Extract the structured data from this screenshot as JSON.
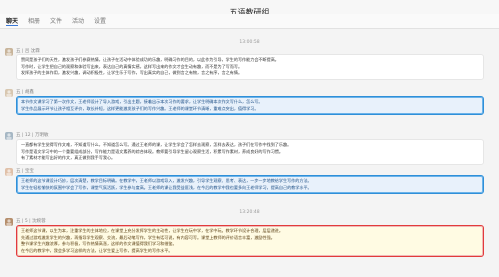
{
  "window": {
    "title": "五语教研组"
  },
  "tabs": [
    {
      "label": "聊天",
      "active": true
    },
    {
      "label": "相册",
      "active": false
    },
    {
      "label": "文件",
      "active": false
    },
    {
      "label": "活动",
      "active": false
    },
    {
      "label": "设置",
      "active": false
    }
  ],
  "messages": [
    {
      "time": "13:00:58",
      "sender": "五 | 吕 沈霖",
      "style": "white",
      "avatar_color": "#c8b49a",
      "lines": [
        "赞同是孩子们的天性，激发孩子们参赛热情，让孩子在活动中体验成功的乐趣，明确习作的目的，以此作为引导，学生的写作能力会不断提高。",
        "写作时，让学生把自己的观察和体验写出来，表达自己的真情实感，这样写出来的作文才会生动有趣，而不是为了写而写。",
        "发挥孩子的主体作用，激发兴趣，调动积极性，让学生乐于写作，写出真实的自己，做到言之有物，言之有序，言之有情。"
      ]
    },
    {
      "time": "",
      "sender": "五 | 胡鑫",
      "style": "blue",
      "avatar_color": "#d8c7b0",
      "lines": [
        "本节作文课学习了第一次作文，王老师设计了导入游戏，引出主题，接着出示本次习作的要求，让学生明确本次作文写什么，怎么写。",
        "学生作品展示环节让孩子相互评价，取长补短，这样更能激发孩子们的写作兴趣。王老师的课堂环节清晰，重难点突出，值得学习。"
      ]
    },
    {
      "time": "",
      "sender": "五 | 12 | 万明敏",
      "style": "white",
      "avatar_color": "#a6b7c4",
      "lines": [
        "一直都有学生觉得写作文难，不知道写什么，不知道怎么写。通过王老师的课，让学生学会了怎样去观察，怎样去表达，孩子们在写作中找到了乐趣。",
        "写作是语文学习中的一个重要组成部分，写作能力是语文素养的综合体现。教师要引导学生留心观察生活，积累写作素材，养成良好的写作习惯。",
        "有了素材才能写出好的作文，真正做到我手写我心。"
      ]
    },
    {
      "time": "",
      "sender": "五 | 宝宝",
      "style": "blue",
      "avatar_color": "#e0c0a8",
      "lines": [
        "王老师的这节课设计巧妙，层次清楚，教学目标明确。在教学中，王老师以游戏导入，激发兴趣，引导学生观察、思考、表达，一步一步地教给学生写作的方法。",
        "学生在轻松愉快的氛围中学会了写作，课堂气氛活跃，学生参与度高。王老师的课让我受益匪浅，在今后的教学中我也要多向王老师学习，提高自己的教学水平。"
      ]
    },
    {
      "time": "13:20:48",
      "sender": "五 | 5 | 沈婉蓉",
      "style": "yellow",
      "avatar_color": "#b58e6c",
      "lines": [
        "王老师这节课，以生为本，注重学生的主体地位，在课堂上充分发挥学生的主动性，让学生在玩中学，在学中玩。教学环节设计合理，层层递进。",
        "先通过游戏激发学生的兴趣，再指导学生观察、交流，最后动笔写作，学生有话可说，有内容可写。课堂上教师的评价语言丰富，激励性强。",
        "整节课学生兴趣浓厚，参与积极，写作热情高涨，这样的作文课值得我们学习和借鉴。",
        "在今后的教学中，我会多学习这样的方法，让学生爱上写作，提高学生的写作水平。"
      ]
    }
  ]
}
